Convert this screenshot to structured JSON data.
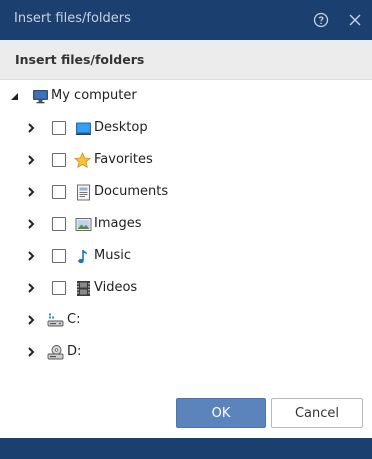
{
  "dialog": {
    "title": "Insert files/folders",
    "subtitle": "Insert files/folders"
  },
  "tree": {
    "root": {
      "label": "My computer",
      "icon": "monitor-icon"
    },
    "items": [
      {
        "label": "Desktop",
        "icon": "desktop-icon",
        "checked": false
      },
      {
        "label": "Favorites",
        "icon": "star-icon",
        "checked": false
      },
      {
        "label": "Documents",
        "icon": "document-icon",
        "checked": false
      },
      {
        "label": "Images",
        "icon": "image-icon",
        "checked": false
      },
      {
        "label": "Music",
        "icon": "music-note-icon",
        "checked": false
      },
      {
        "label": "Videos",
        "icon": "film-icon",
        "checked": false
      }
    ],
    "drives": [
      {
        "label": "C:",
        "icon": "hard-drive-icon"
      },
      {
        "label": "D:",
        "icon": "optical-drive-icon"
      }
    ]
  },
  "buttons": {
    "ok": "OK",
    "cancel": "Cancel"
  },
  "colors": {
    "titlebar": "#1b3f6e",
    "primary_button": "#5b84bd"
  }
}
